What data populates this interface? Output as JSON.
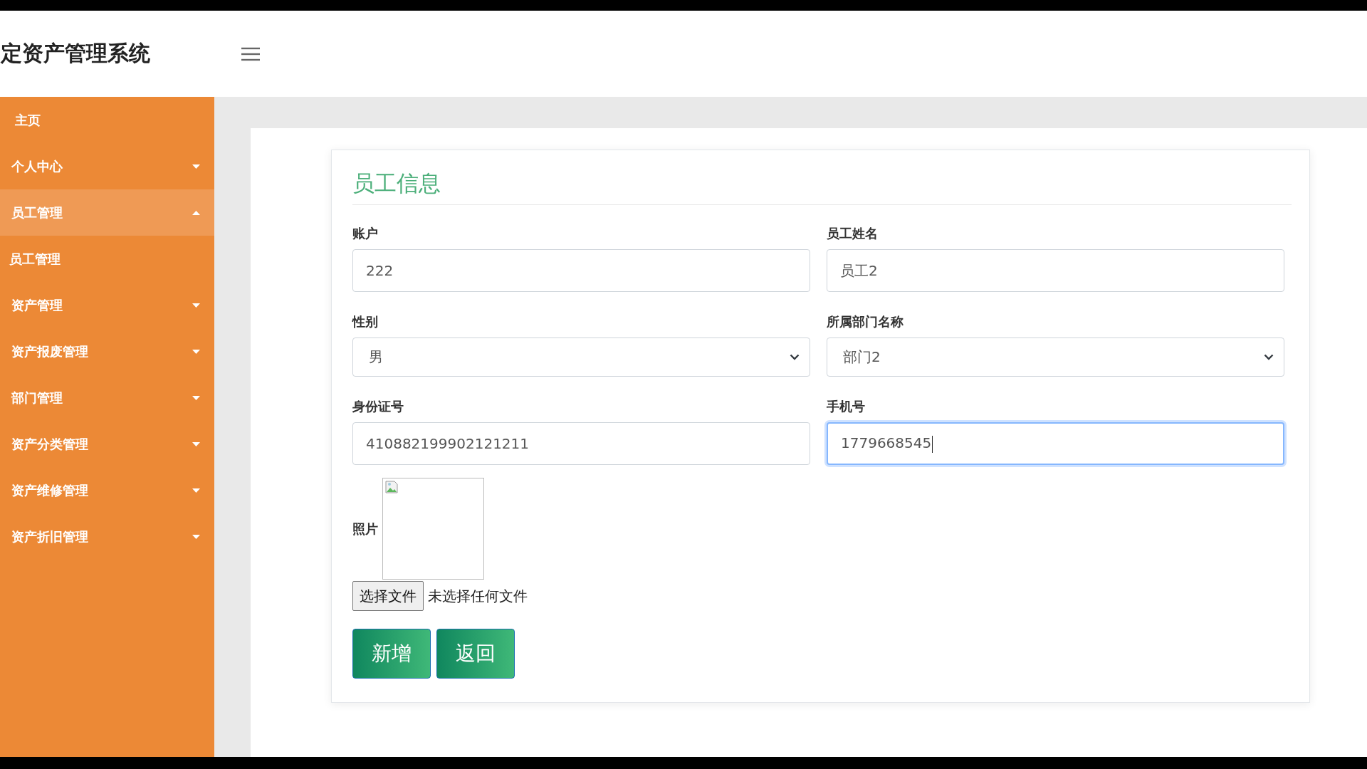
{
  "header": {
    "title": "定资产管理系统"
  },
  "sidebar": {
    "items": [
      {
        "label": "主页",
        "kind": "link"
      },
      {
        "label": "个人中心",
        "kind": "menu",
        "expanded": false
      },
      {
        "label": "员工管理",
        "kind": "menu",
        "expanded": true,
        "children": [
          {
            "label": "员工管理"
          }
        ]
      },
      {
        "label": "资产管理",
        "kind": "menu",
        "expanded": false
      },
      {
        "label": "资产报废管理",
        "kind": "menu",
        "expanded": false
      },
      {
        "label": "部门管理",
        "kind": "menu",
        "expanded": false
      },
      {
        "label": "资产分类管理",
        "kind": "menu",
        "expanded": false
      },
      {
        "label": "资产维修管理",
        "kind": "menu",
        "expanded": false
      },
      {
        "label": "资产折旧管理",
        "kind": "menu",
        "expanded": false
      }
    ]
  },
  "form": {
    "title": "员工信息",
    "fields": [
      {
        "label": "账户",
        "kind": "text",
        "value": "222",
        "focused": false
      },
      {
        "label": "员工姓名",
        "kind": "text",
        "value": "员工2",
        "focused": false
      },
      {
        "label": "性别",
        "kind": "select",
        "value": "男",
        "focused": false
      },
      {
        "label": "所属部门名称",
        "kind": "select",
        "value": "部门2",
        "focused": false
      },
      {
        "label": "身份证号",
        "kind": "text",
        "value": "410882199902121211",
        "focused": false
      },
      {
        "label": "手机号",
        "kind": "text",
        "value": "1779668545",
        "focused": true
      }
    ],
    "photo": {
      "label": "照片",
      "file_button": "选择文件",
      "file_status": "未选择任何文件"
    },
    "buttons": [
      "新增",
      "返回"
    ]
  }
}
